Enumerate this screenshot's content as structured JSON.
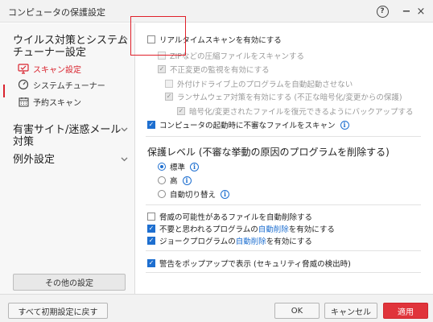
{
  "window": {
    "title": "コンピュータの保護設定",
    "help_label": "?",
    "minimize_label": "−",
    "close_label": "×"
  },
  "sidebar": {
    "sec1_line1": "ウイルス対策とシステム",
    "sec1_line2": "チューナー設定",
    "sec1_chevron": "^",
    "items": [
      {
        "label": "スキャン設定",
        "icon": "monitor-icon"
      },
      {
        "label": "システムチューナー",
        "icon": "gauge-icon"
      },
      {
        "label": "予約スキャン",
        "icon": "calendar-icon"
      }
    ],
    "sec2_line1": "有害サイト/迷惑メール",
    "sec2_line2": "対策",
    "sec2_chevron": "v",
    "sec3": "例外設定",
    "sec3_chevron": "v",
    "other_button": "その他の設定"
  },
  "main": {
    "realtime_scan": {
      "label": "リアルタイムスキャンを有効にする",
      "checked": false
    },
    "zip_scan": {
      "label": "ZIPなどの圧縮ファイルをスキャンする",
      "checked": false,
      "disabled": true
    },
    "tamper_monitor": {
      "label": "不正変更の監視を有効にする",
      "checked": true,
      "disabled": true
    },
    "external_drive": {
      "label": "外付けドライブ上のプログラムを自動起動させない",
      "checked": false,
      "disabled": true
    },
    "ransomware": {
      "label": "ランサムウェア対策を有効にする (不正な暗号化/変更からの保護)",
      "checked": true,
      "disabled": true
    },
    "backup": {
      "label": "暗号化/変更されたファイルを復元できるようにバックアップする",
      "checked": true,
      "disabled": true
    },
    "startup_scan": {
      "label": "コンピュータの起動時に不審なファイルをスキャン",
      "checked": true
    },
    "level_title": "保護レベル (不審な挙動の原因のプログラムを削除する)",
    "levels": [
      {
        "label": "標準",
        "selected": true,
        "info": true
      },
      {
        "label": "高",
        "selected": false,
        "info": true
      },
      {
        "label": "自動切り替え",
        "selected": false,
        "info": true
      }
    ],
    "auto_delete_threat": {
      "label": "脅威の可能性があるファイルを自動削除する",
      "checked": false
    },
    "auto_delete_unwanted": {
      "pre": "不要と思われるプログラムの",
      "link": "自動削除",
      "post": "を有効にする",
      "checked": true
    },
    "auto_delete_joke": {
      "pre": "ジョークプログラムの",
      "link": "自動削除",
      "post": "を有効にする",
      "checked": true
    },
    "popup_warning": {
      "label": "警告をポップアップで表示 (セキュリティ脅威の検出時)",
      "checked": true
    },
    "info_glyph": "i",
    "check_glyph": "✓"
  },
  "footer": {
    "reset": "すべて初期設定に戻す",
    "ok": "OK",
    "cancel": "キャンセル",
    "apply": "適用"
  },
  "colors": {
    "accent_blue": "#1e6fd0",
    "accent_red": "#d9232e",
    "apply_red": "#e0343b",
    "highlight_box": "#e0202a"
  }
}
